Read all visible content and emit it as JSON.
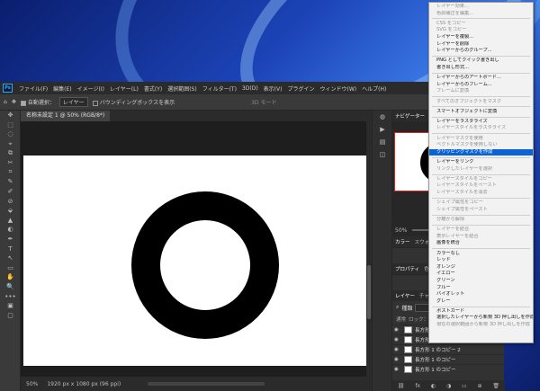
{
  "window": {
    "title": "名称未設定 1 @ 50% (RGB/8*)"
  },
  "menubar": {
    "logo": "Ps",
    "items": [
      "ファイル(F)",
      "編集(E)",
      "イメージ(I)",
      "レイヤー(L)",
      "書式(Y)",
      "選択範囲(S)",
      "フィルター(T)",
      "3D(D)",
      "表示(V)",
      "プラグイン",
      "ウィンドウ(W)",
      "ヘルプ(H)"
    ]
  },
  "options": {
    "home_icon": "⌂",
    "move_icon": "✥",
    "auto_select_label": "自動選択：",
    "auto_select_value": "レイヤー",
    "bounding_box_label": "バウンディングボックスを表示",
    "mode_3d": "3D モード"
  },
  "status": {
    "zoom": "50%",
    "info": "1920 px x 1080 px (96 ppi)"
  },
  "toolbar": {
    "tools": [
      "✥",
      "⬚",
      "◌",
      "⌖",
      "⧉",
      "✂",
      "⌗",
      "✎",
      "✐",
      "⊘",
      "⬙",
      "▲",
      "◐",
      "✒",
      "T",
      "↖",
      "▭",
      "✋",
      "🔍",
      "•••",
      "▣",
      "▢"
    ]
  },
  "dock": {
    "icons": [
      "◍",
      "▶",
      "▤",
      "◫"
    ]
  },
  "panels": {
    "navigator_tabs": [
      "ナビゲーター",
      "ヒストグラム"
    ],
    "navigator_zoom": "50%",
    "color_tabs": [
      "カラー",
      "スウォッチ"
    ],
    "properties_tabs": [
      "プロパティ",
      "色調補正"
    ],
    "layers_tabs": [
      "レイヤー",
      "チャンネル",
      "パス"
    ],
    "layers_kind": "種類",
    "layers_normal": "通常",
    "lock_label": "ロック：",
    "layers": [
      "長方形 1",
      "長方形 1 のコピー",
      "長方形 1 のコピー 2",
      "長方形 1 のコピー",
      "長方形 1 のコピー"
    ],
    "footer_icons": [
      "⛓",
      "fx",
      "◐",
      "◑",
      "▭",
      "⊕",
      "🗑"
    ]
  },
  "context_menu": {
    "items": [
      {
        "label": "レイヤー効果...",
        "state": "disabled"
      },
      {
        "label": "色調補正を編集...",
        "state": "disabled"
      },
      {
        "sep": true
      },
      {
        "label": "CSS をコピー",
        "state": "disabled"
      },
      {
        "label": "SVG をコピー",
        "state": "disabled"
      },
      {
        "label": "レイヤーを複製...",
        "state": "normal"
      },
      {
        "label": "レイヤーを削除",
        "state": "normal"
      },
      {
        "label": "レイヤーからのグループ...",
        "state": "normal"
      },
      {
        "sep": true
      },
      {
        "label": "PNG としてクイック書き出し",
        "state": "normal"
      },
      {
        "label": "書き出し形式...",
        "state": "normal"
      },
      {
        "sep": true
      },
      {
        "label": "レイヤーからのアートボード...",
        "state": "normal"
      },
      {
        "label": "レイヤーからのフレーム...",
        "state": "normal"
      },
      {
        "label": "フレームに変換",
        "state": "disabled"
      },
      {
        "sep": true
      },
      {
        "label": "すべてのオブジェクトをマスク",
        "state": "disabled"
      },
      {
        "sep": true
      },
      {
        "label": "スマートオブジェクトに変換",
        "state": "normal"
      },
      {
        "sep": true
      },
      {
        "label": "レイヤーをラスタライズ",
        "state": "normal"
      },
      {
        "label": "レイヤースタイルをラスタライズ",
        "state": "disabled"
      },
      {
        "sep": true
      },
      {
        "label": "レイヤーマスクを使用",
        "state": "disabled"
      },
      {
        "label": "ベクトルマスクを使用しない",
        "state": "disabled"
      },
      {
        "label": "クリッピングマスクを作成",
        "state": "highlight"
      },
      {
        "sep": true
      },
      {
        "label": "レイヤーをリンク",
        "state": "normal"
      },
      {
        "label": "リンクしたレイヤーを選択",
        "state": "disabled"
      },
      {
        "sep": true
      },
      {
        "label": "レイヤースタイルをコピー",
        "state": "disabled"
      },
      {
        "label": "レイヤースタイルをペースト",
        "state": "disabled"
      },
      {
        "label": "レイヤースタイルを消去",
        "state": "disabled"
      },
      {
        "sep": true
      },
      {
        "label": "シェイプ属性をコピー",
        "state": "disabled"
      },
      {
        "label": "シェイプ属性をペースト",
        "state": "disabled"
      },
      {
        "sep": true
      },
      {
        "label": "分離から解除",
        "state": "disabled"
      },
      {
        "sep": true
      },
      {
        "label": "レイヤーを結合",
        "state": "disabled"
      },
      {
        "label": "表示レイヤーを結合",
        "state": "disabled"
      },
      {
        "label": "画像を統合",
        "state": "normal"
      },
      {
        "sep": true
      },
      {
        "label": "カラーなし",
        "state": "normal"
      },
      {
        "label": "レッド",
        "state": "normal"
      },
      {
        "label": "オレンジ",
        "state": "normal"
      },
      {
        "label": "イエロー",
        "state": "normal"
      },
      {
        "label": "グリーン",
        "state": "normal"
      },
      {
        "label": "ブルー",
        "state": "normal"
      },
      {
        "label": "バイオレット",
        "state": "normal"
      },
      {
        "label": "グレー",
        "state": "normal"
      },
      {
        "sep": true
      },
      {
        "label": "ポストカード",
        "state": "normal"
      },
      {
        "label": "選択したレイヤーから新規 3D 押し出しを作成",
        "state": "normal"
      },
      {
        "label": "現在の選択範囲から新規 3D 押し出しを作成",
        "state": "disabled"
      }
    ]
  },
  "colors": {
    "accent": "#0a64d8",
    "ps_bg": "#323232",
    "artboard": "#ffffff",
    "shape": "#000000"
  }
}
